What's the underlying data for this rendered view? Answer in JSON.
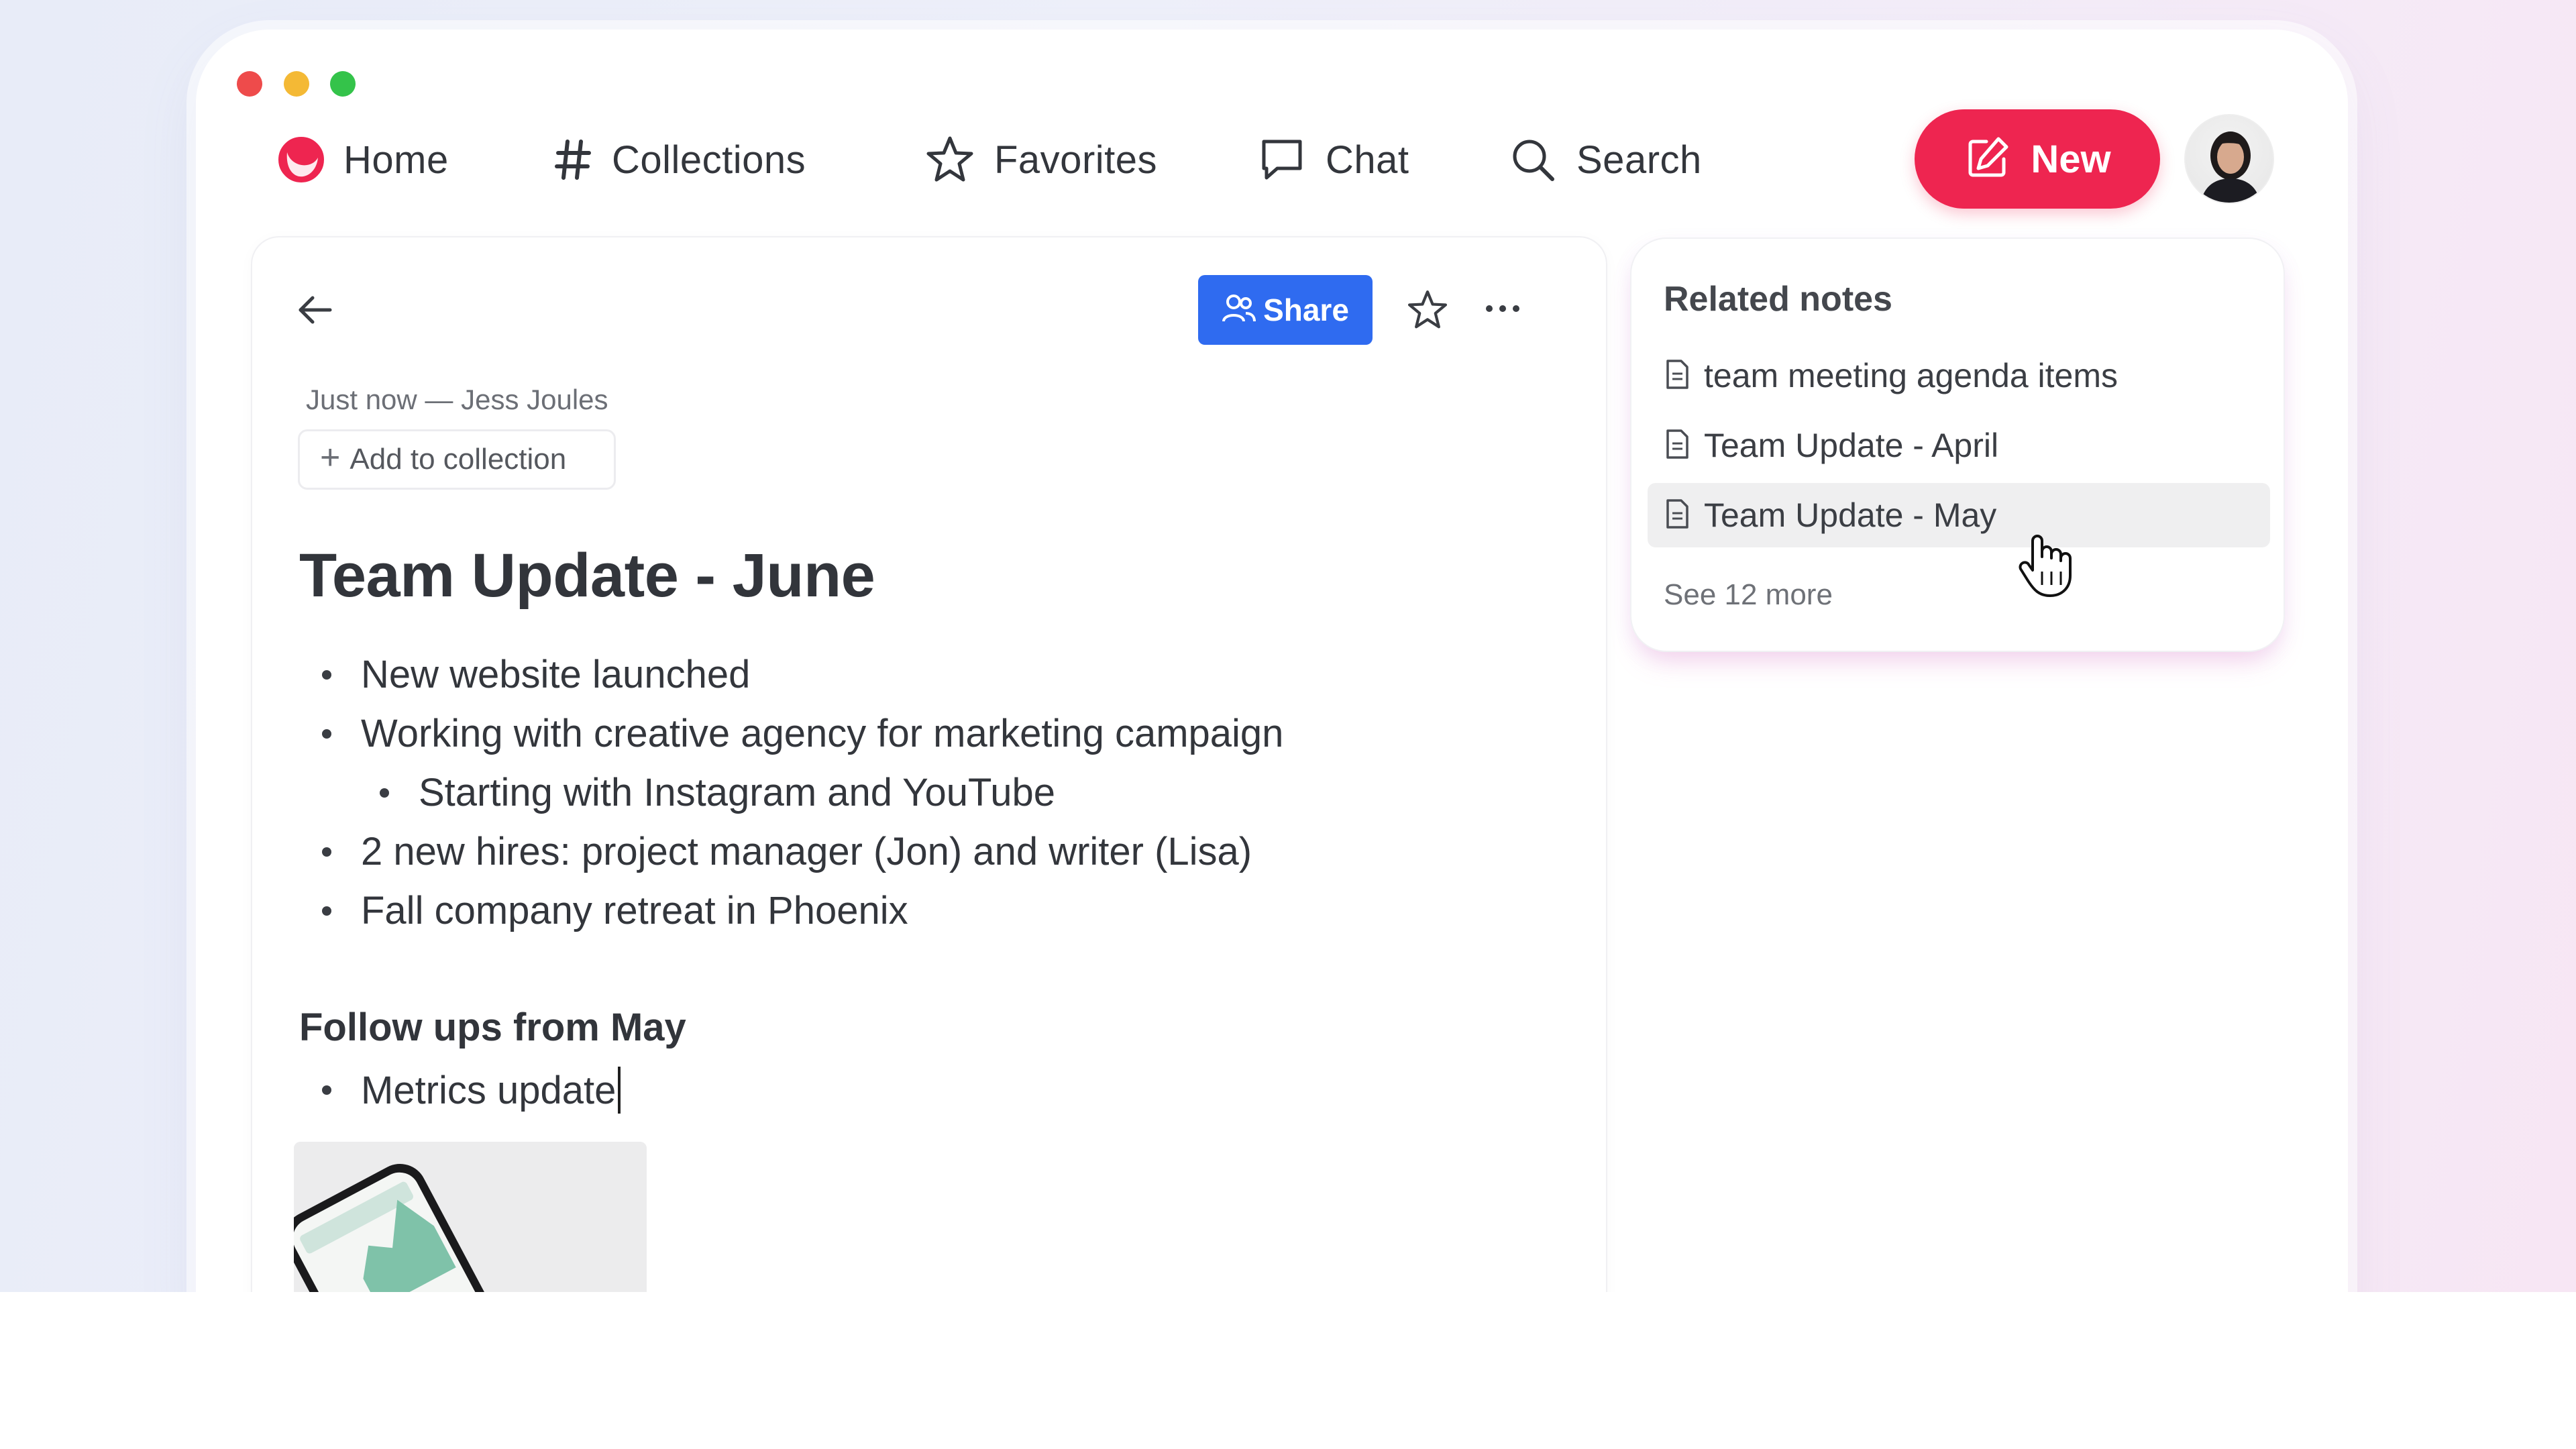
{
  "nav": {
    "home_label": "Home",
    "collections_label": "Collections",
    "favorites_label": "Favorites",
    "chat_label": "Chat",
    "search_label": "Search",
    "new_label": "New"
  },
  "icons": {
    "home": "logo-icon",
    "collections": "hash-icon",
    "favorites": "star-icon",
    "chat": "chat-bubble-icon",
    "search": "search-icon",
    "new": "edit-icon",
    "back": "arrow-left-icon",
    "share": "people-icon",
    "star": "star-icon",
    "more": "ellipsis-icon",
    "note": "document-icon"
  },
  "colors": {
    "accent": "#ee2550",
    "share": "#2f6bf0"
  },
  "note": {
    "meta": "Just now — Jess Joules",
    "add_to_collection": "Add to collection",
    "share_label": "Share",
    "title": "Team Update - June",
    "bullets": [
      "New website launched",
      "Working with creative agency for marketing campaign",
      "Starting with Instagram and YouTube",
      "2 new hires: project manager (Jon) and writer (Lisa)",
      "Fall company retreat in Phoenix"
    ],
    "followups_heading": "Follow ups from May",
    "followups": [
      "Metrics update"
    ]
  },
  "related": {
    "heading": "Related notes",
    "items": [
      "team meeting agenda items",
      "Team Update - April",
      "Team Update - May"
    ],
    "see_more": "See 12 more"
  }
}
